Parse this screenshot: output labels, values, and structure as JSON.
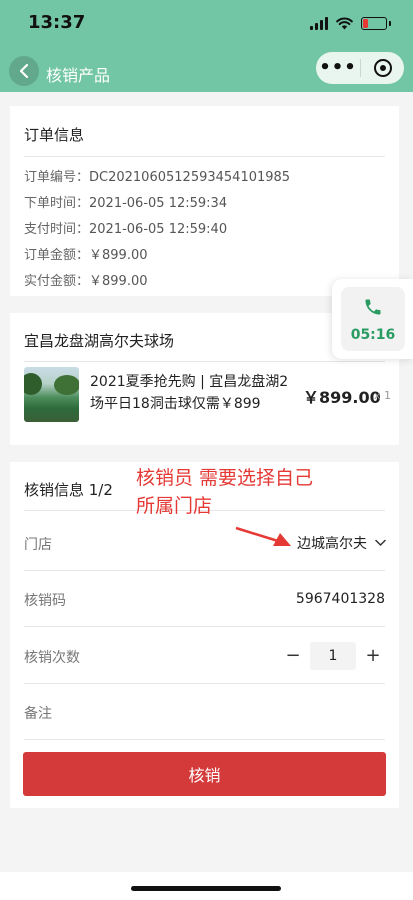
{
  "status_bar": {
    "time": "13:37"
  },
  "nav": {
    "title": "核销产品"
  },
  "order": {
    "heading": "订单信息",
    "rows": [
      {
        "label": "订单编号：",
        "value": "DC2021060512593454101985"
      },
      {
        "label": "下单时间：",
        "value": "2021-06-05 12:59:34"
      },
      {
        "label": "支付时间：",
        "value": "2021-06-05 12:59:40"
      },
      {
        "label": "订单金额：",
        "value": "￥899.00"
      },
      {
        "label": "实付金额：",
        "value": "￥899.00"
      }
    ]
  },
  "product": {
    "store_heading": "宜昌龙盘湖高尔夫球场",
    "title": "2021夏季抢先购 | 宜昌龙盘湖2场平日18洞击球仅需￥899",
    "price": "￥899.00",
    "quantity": "x 1"
  },
  "call": {
    "duration": "05:16"
  },
  "redeem": {
    "heading": "核销信息 1/2",
    "store_label": "门店",
    "store_value": "边城高尔夫",
    "code_label": "核销码",
    "code_value": "5967401328",
    "count_label": "核销次数",
    "count_value": "1",
    "minus": "−",
    "plus": "+",
    "note_label": "备注",
    "submit": "核销"
  },
  "annotation": {
    "line1": "核销员 需要选择自己",
    "line2": "所属门店"
  },
  "colors": {
    "header": "#72c6a5",
    "submit": "#d53a3a",
    "annotation": "#e53935",
    "call_time": "#2a9c62"
  }
}
